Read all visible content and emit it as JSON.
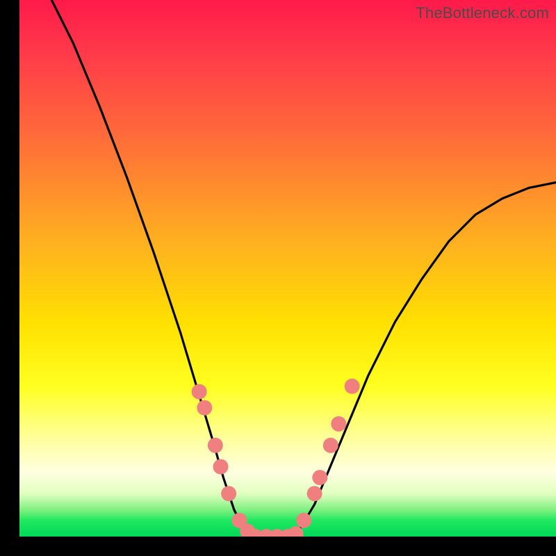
{
  "watermark": "TheBottleneck.com",
  "chart_data": {
    "type": "line",
    "title": "",
    "xlabel": "",
    "ylabel": "",
    "xlim": [
      0,
      100
    ],
    "ylim": [
      0,
      100
    ],
    "series": [
      {
        "name": "bottleneck-curve",
        "x": [
          6,
          10,
          15,
          20,
          25,
          30,
          33,
          36,
          38,
          40,
          42,
          44,
          46,
          48,
          50,
          52,
          55,
          60,
          65,
          70,
          75,
          80,
          85,
          90,
          95,
          100
        ],
        "values": [
          100,
          92,
          80,
          67,
          53,
          38,
          28,
          18,
          11,
          5,
          1,
          0,
          0,
          0,
          0,
          1,
          6,
          18,
          30,
          40,
          48,
          55,
          60,
          63,
          65,
          66
        ]
      }
    ],
    "markers": {
      "name": "highlighted-points",
      "color": "#f08080",
      "points": [
        {
          "x": 33.5,
          "y": 27
        },
        {
          "x": 34.5,
          "y": 24
        },
        {
          "x": 36.5,
          "y": 17
        },
        {
          "x": 37.5,
          "y": 13
        },
        {
          "x": 39.0,
          "y": 8
        },
        {
          "x": 41.0,
          "y": 3
        },
        {
          "x": 42.5,
          "y": 1
        },
        {
          "x": 44.0,
          "y": 0
        },
        {
          "x": 46.0,
          "y": 0
        },
        {
          "x": 48.0,
          "y": 0
        },
        {
          "x": 50.0,
          "y": 0
        },
        {
          "x": 51.5,
          "y": 0.5
        },
        {
          "x": 53.0,
          "y": 3
        },
        {
          "x": 55.0,
          "y": 8
        },
        {
          "x": 56.0,
          "y": 11
        },
        {
          "x": 58.0,
          "y": 17
        },
        {
          "x": 59.5,
          "y": 21
        },
        {
          "x": 62.0,
          "y": 28
        }
      ]
    }
  }
}
